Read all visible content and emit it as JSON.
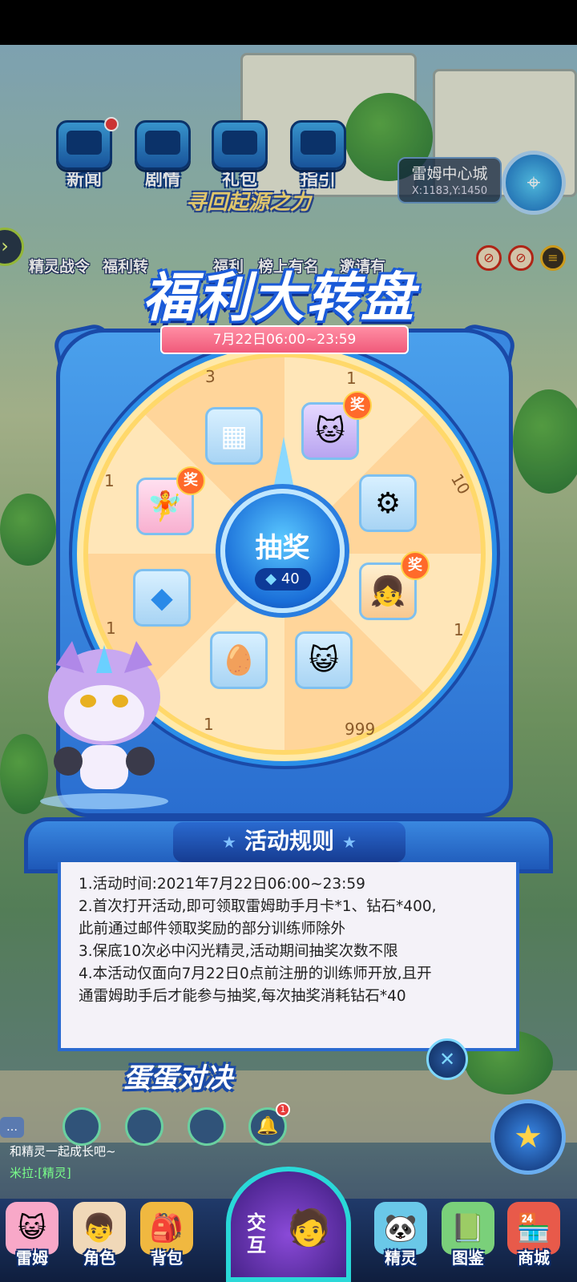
{
  "top_icons": [
    {
      "label": "新闻",
      "icon": "tv-news-icon"
    },
    {
      "label": "剧情",
      "icon": "tv-story-icon"
    },
    {
      "label": "礼包",
      "icon": "tv-gift-icon"
    },
    {
      "label": "指引",
      "icon": "tv-guide-icon"
    }
  ],
  "location": {
    "name": "雷姆中心城",
    "coord": "X:1183,Y:1450"
  },
  "event_banner": "寻回起源之力",
  "row2": {
    "labels": [
      "精灵战令",
      "福利转",
      "福利",
      "榜上有名",
      "邀请有"
    ]
  },
  "wheel": {
    "title": "福利大转盘",
    "date_range": "7月22日06:00~23:59",
    "draw_button": "抽奖",
    "cost": "40",
    "badge_text": "奖",
    "slot_counts": [
      "1",
      "10",
      "1",
      "999",
      "1",
      "1",
      "1",
      "3"
    ],
    "prizes": [
      {
        "icon": "purple-cat-sprite-icon",
        "badge": true
      },
      {
        "icon": "red-gear-item-icon",
        "badge": false
      },
      {
        "icon": "blonde-sprite-icon",
        "badge": true
      },
      {
        "icon": "yellow-cat-face-icon",
        "badge": false
      },
      {
        "icon": "sprite-egg-icon",
        "badge": false
      },
      {
        "icon": "blue-crystal-icon",
        "badge": false
      },
      {
        "icon": "pink-sprite-icon",
        "badge": true
      },
      {
        "icon": "sugar-cubes-icon",
        "badge": false
      }
    ]
  },
  "rules": {
    "title": "活动规则",
    "lines": [
      "1.活动时间:2021年7月22日06:00~23:59",
      "2.首次打开活动,即可领取雷姆助手月卡*1、钻石*400,",
      "此前通过邮件领取奖励的部分训练师除外",
      "3.保底10次必中闪光精灵,活动期间抽奖次数不限",
      "4.本活动仅面向7月22日0点前注册的训练师开放,且开",
      "通雷姆助手后才能参与抽奖,每次抽奖消耗钻石*40"
    ]
  },
  "egg_banner": "蛋蛋对决",
  "notification_count": "1",
  "chat": {
    "line1": "和精灵一起成长吧~",
    "speaker": "米拉:",
    "tag": "[精灵]"
  },
  "bottom_nav": [
    {
      "label": "雷姆"
    },
    {
      "label": "角色"
    },
    {
      "label": "背包"
    },
    {
      "label": "精灵"
    },
    {
      "label": "图鉴"
    },
    {
      "label": "商城"
    }
  ],
  "interact_label": "交互",
  "colors": {
    "accent_blue": "#2a6ed0",
    "wheel_light": "#ffe6b8",
    "wheel_dark": "#ffd59a",
    "badge": "#ff6a2a",
    "ribbon": "#f05a7a"
  }
}
